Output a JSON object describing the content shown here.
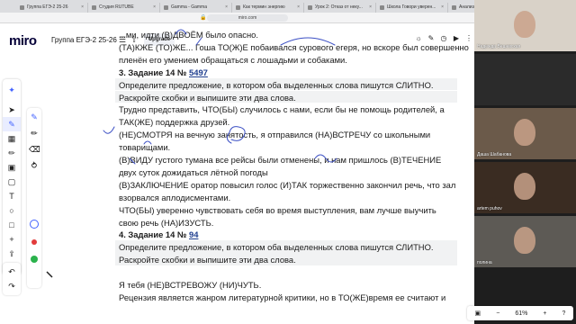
{
  "browser": {
    "tabs": [
      {
        "title": "Группа ЕГЭ-2 25-26"
      },
      {
        "title": "Студия RUTUBE"
      },
      {
        "title": "Gamma - Gamma"
      },
      {
        "title": "Как термин энергию"
      },
      {
        "title": "Урок 2: Отказ от неку..."
      },
      {
        "title": "Школа Говори уверен..."
      },
      {
        "title": "Анализ пуб"
      }
    ],
    "url": "miro.com"
  },
  "toolbar": {
    "logo": "miro",
    "board_name": "Группа ЕГЭ-2 25-26",
    "upgrade_label": "Upgrade"
  },
  "document": {
    "lines": [
      {
        "text": "...ми, идти (В)ДВОЁМ было опасно.",
        "bold": false
      },
      {
        "text": "(ТА)КЖЕ (ТО)ЖЕ... Гоша ТО(Ж)Е побаивался сурового егеря, но вскоре был совершенно",
        "bold": false
      },
      {
        "text": "пленён его умением обращаться с лошадьми и собаками.",
        "bold": false
      },
      {
        "text": "3. Задание 14 № ",
        "bold": true,
        "link": "5497"
      },
      {
        "text": "Определите предложение, в котором оба выделенных слова пишутся СЛИТНО.",
        "bold": false,
        "shaded": true
      },
      {
        "text": "Раскройте скобки и выпишите эти два слова.",
        "bold": false,
        "shaded": true
      },
      {
        "text": "Трудно представить, ЧТО(БЫ) случилось с нами, если бы не помощь родителей, а",
        "bold": false
      },
      {
        "text": "ТАК(ЖЕ) поддержка друзей.",
        "bold": false
      },
      {
        "text": "(НЕ)СМОТРЯ на вечную занятость, я отправился (НА)ВСТРЕЧУ со школьными",
        "bold": false
      },
      {
        "text": "товарищами.",
        "bold": false
      },
      {
        "text": "(В)ВИДУ густого тумана все рейсы были отменены, и нам пришлось (В)ТЕЧЕНИЕ",
        "bold": false
      },
      {
        "text": "двух суток дожидаться лётной погоды",
        "bold": false
      },
      {
        "text": "(В)ЗАКЛЮЧЕНИЕ оратор повысил голос (И)ТАК торжественно закончил речь, что зал",
        "bold": false
      },
      {
        "text": "взорвался аплодисментами.",
        "bold": false
      },
      {
        "text": "ЧТО(БЫ) уверенно чувствовать себя во время выступления, вам лучше выучить",
        "bold": false
      },
      {
        "text": "свою речь (НА)ИЗУСТЬ.",
        "bold": false
      },
      {
        "text": "4. Задание 14 № ",
        "bold": true,
        "link": "94"
      },
      {
        "text": "Определите предложение, в котором оба выделенных слова пишутся СЛИТНО.",
        "bold": false,
        "shaded": true
      },
      {
        "text": "Раскройте скобки и выпишите эти два слова.",
        "bold": false,
        "shaded": true
      },
      {
        "text": "",
        "bold": false
      },
      {
        "text": "Я тебя (НЕ)ВСТРЕВОЖУ (НИ)ЧУТЬ.",
        "bold": false
      },
      {
        "text": "Рецензия является жанром литературной критики, но в ТО(ЖЕ)время ее считают и",
        "bold": false
      }
    ]
  },
  "participants": [
    {
      "name": "Надежда Вешевская",
      "bg": "#d9d2c8"
    },
    {
      "name": "",
      "bg": "#2b2b2b"
    },
    {
      "name": "Даша Шабанова",
      "bg": "#6b5a4a"
    },
    {
      "name": "artem puhov",
      "bg": "#3a2c22"
    },
    {
      "name": "полина",
      "bg": "#5d5a55"
    },
    {
      "name": "",
      "bg": "#1e1e1e"
    }
  ],
  "zoom": {
    "level": "61%"
  },
  "colors": {
    "accent": "#4262ff",
    "ink": "#3b4fc4"
  }
}
